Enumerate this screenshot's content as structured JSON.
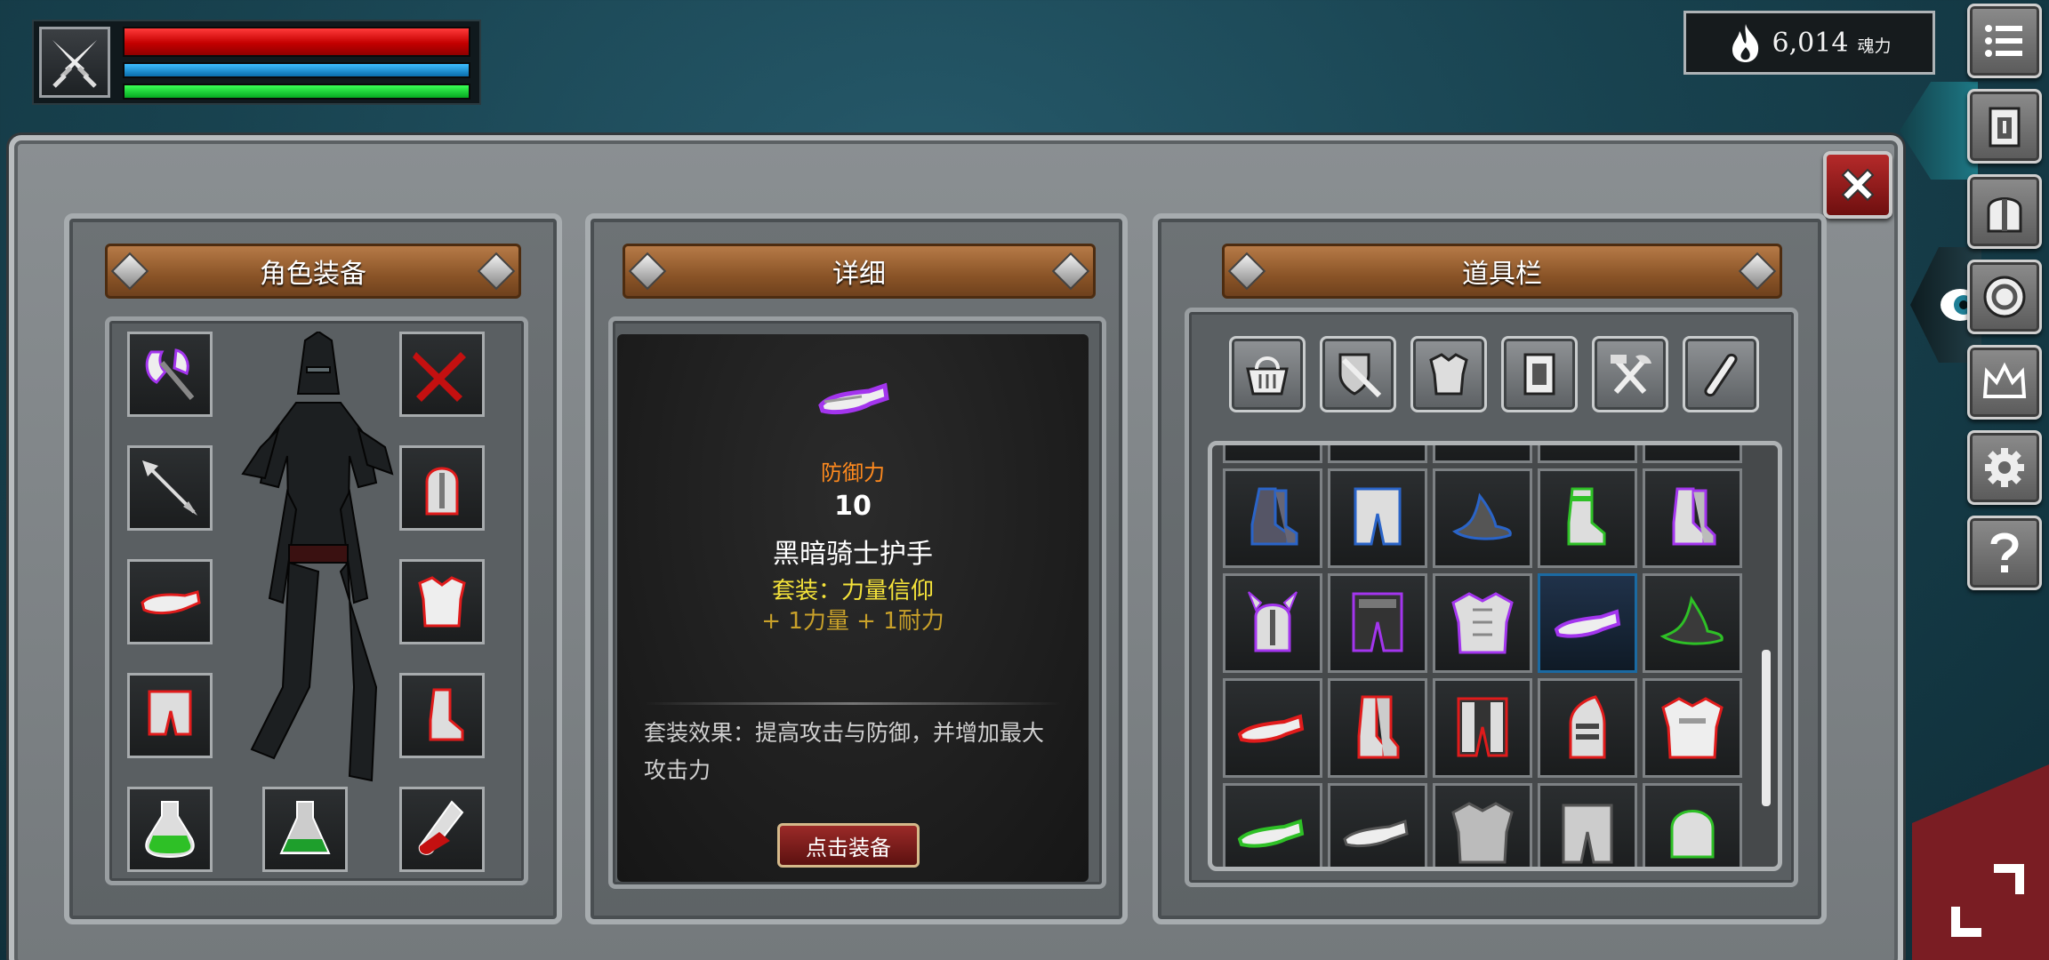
{
  "hud": {
    "hp_fraction": 1.0,
    "mp_fraction": 1.0,
    "stamina_fraction": 1.0,
    "icon": "crossed-swords-icon"
  },
  "currency": {
    "value": "6,014",
    "unit": "魂力",
    "icon": "flame-icon"
  },
  "side_menu": [
    "menu-icon",
    "armor-icon",
    "helmet-icon",
    "amulet-icon",
    "crown-icon",
    "gear-icon",
    "help-icon"
  ],
  "panels": {
    "equipment": {
      "title": "角色装备"
    },
    "detail": {
      "title": "详细",
      "attribute_label": "防御力",
      "attribute_value": "10",
      "item_name": "黑暗骑士护手",
      "set_line": "套装：力量信仰",
      "set_bonus": "+ 1力量  + 1耐力",
      "set_effect": "套装效果：提高攻击与防御，并增加最大攻击力",
      "equip_button": "点击装备"
    },
    "inventory": {
      "title": "道具栏"
    }
  },
  "colors": {
    "rarity_purple": "#a335ee",
    "rarity_red": "#e01b1b",
    "rarity_green": "#2ec026",
    "rarity_blue": "#2a64c8",
    "selected": "#1b6aa2"
  }
}
